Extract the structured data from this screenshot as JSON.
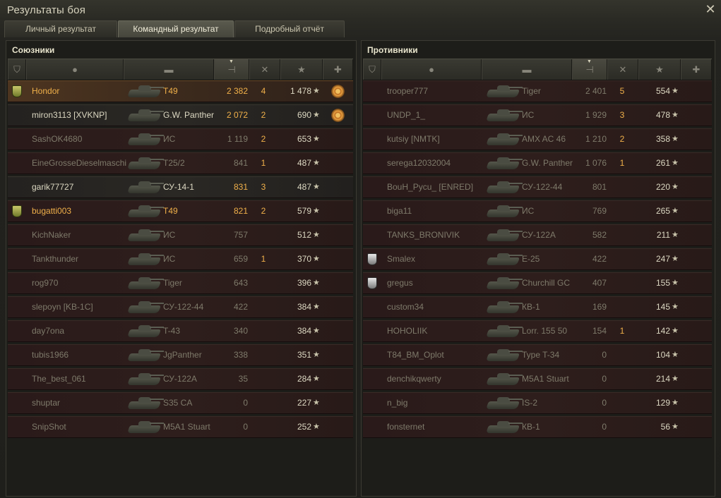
{
  "window": {
    "title": "Результаты боя"
  },
  "tabs": [
    {
      "label": "Личный результат",
      "active": false
    },
    {
      "label": "Командный результат",
      "active": true
    },
    {
      "label": "Подробный отчёт",
      "active": false
    }
  ],
  "allies": {
    "title": "Союзники",
    "rows": [
      {
        "badge": "gold",
        "name": "Hondor",
        "tank": "T49",
        "damage": "2 382",
        "frags": "4",
        "xp": "1 478",
        "medal": true,
        "style": "mine"
      },
      {
        "badge": "",
        "name": "miron3113 [XVKNP]",
        "tank": "G.W. Panther",
        "damage": "2 072",
        "frags": "2",
        "xp": "690",
        "medal": true,
        "style": "bright"
      },
      {
        "badge": "",
        "name": "SashOK4680",
        "tank": "ИС",
        "damage": "1 119",
        "frags": "2",
        "xp": "653",
        "medal": false,
        "style": "dead"
      },
      {
        "badge": "",
        "name": "EineGrosseDieselmaschi",
        "tank": "T25/2",
        "damage": "841",
        "frags": "1",
        "xp": "487",
        "medal": false,
        "style": "dead"
      },
      {
        "badge": "",
        "name": "garik77727",
        "tank": "СУ-14-1",
        "damage": "831",
        "frags": "3",
        "xp": "487",
        "medal": false,
        "style": "bright"
      },
      {
        "badge": "gold",
        "name": "bugatti003",
        "tank": "T49",
        "damage": "821",
        "frags": "2",
        "xp": "579",
        "medal": false,
        "style": "platoon"
      },
      {
        "badge": "",
        "name": "KichNaker",
        "tank": "ИС",
        "damage": "757",
        "frags": "",
        "xp": "512",
        "medal": false,
        "style": "dead"
      },
      {
        "badge": "",
        "name": "Tankthunder",
        "tank": "ИС",
        "damage": "659",
        "frags": "1",
        "xp": "370",
        "medal": false,
        "style": "dead"
      },
      {
        "badge": "",
        "name": "rog970",
        "tank": "Tiger",
        "damage": "643",
        "frags": "",
        "xp": "396",
        "medal": false,
        "style": "dead"
      },
      {
        "badge": "",
        "name": "slepoyn [KB-1C]",
        "tank": "СУ-122-44",
        "damage": "422",
        "frags": "",
        "xp": "384",
        "medal": false,
        "style": "dead"
      },
      {
        "badge": "",
        "name": "day7ona",
        "tank": "T-43",
        "damage": "340",
        "frags": "",
        "xp": "384",
        "medal": false,
        "style": "dead"
      },
      {
        "badge": "",
        "name": "tubis1966",
        "tank": "JgPanther",
        "damage": "338",
        "frags": "",
        "xp": "351",
        "medal": false,
        "style": "dead"
      },
      {
        "badge": "",
        "name": "The_best_061",
        "tank": "СУ-122А",
        "damage": "35",
        "frags": "",
        "xp": "284",
        "medal": false,
        "style": "dead"
      },
      {
        "badge": "",
        "name": "shuptar",
        "tank": "S35 CA",
        "damage": "0",
        "frags": "",
        "xp": "227",
        "medal": false,
        "style": "dead"
      },
      {
        "badge": "",
        "name": "SnipShot",
        "tank": "M5A1 Stuart",
        "damage": "0",
        "frags": "",
        "xp": "252",
        "medal": false,
        "style": "dead"
      }
    ]
  },
  "enemies": {
    "title": "Противники",
    "rows": [
      {
        "badge": "",
        "name": "trooper777",
        "tank": "Tiger",
        "damage": "2 401",
        "frags": "5",
        "xp": "554",
        "medal": false,
        "style": "dead"
      },
      {
        "badge": "",
        "name": "UNDP_1_",
        "tank": "ИС",
        "damage": "1 929",
        "frags": "3",
        "xp": "478",
        "medal": false,
        "style": "dead"
      },
      {
        "badge": "",
        "name": "kutsiy [NMTK]",
        "tank": "AMX AC 46",
        "damage": "1 210",
        "frags": "2",
        "xp": "358",
        "medal": false,
        "style": "dead"
      },
      {
        "badge": "",
        "name": "serega12032004",
        "tank": "G.W. Panther",
        "damage": "1 076",
        "frags": "1",
        "xp": "261",
        "medal": false,
        "style": "dead"
      },
      {
        "badge": "",
        "name": "BouH_Pycu_ [ENRED]",
        "tank": "СУ-122-44",
        "damage": "801",
        "frags": "",
        "xp": "220",
        "medal": false,
        "style": "dead"
      },
      {
        "badge": "",
        "name": "biga11",
        "tank": "ИС",
        "damage": "769",
        "frags": "",
        "xp": "265",
        "medal": false,
        "style": "dead"
      },
      {
        "badge": "",
        "name": "TANKS_BRONIVIK",
        "tank": "СУ-122А",
        "damage": "582",
        "frags": "",
        "xp": "211",
        "medal": false,
        "style": "dead"
      },
      {
        "badge": "silver",
        "name": "Smalex",
        "tank": "E-25",
        "damage": "422",
        "frags": "",
        "xp": "247",
        "medal": false,
        "style": "dead"
      },
      {
        "badge": "silver",
        "name": "gregus",
        "tank": "Churchill GC",
        "damage": "407",
        "frags": "",
        "xp": "155",
        "medal": false,
        "style": "dead"
      },
      {
        "badge": "",
        "name": "custom34",
        "tank": "КВ-1",
        "damage": "169",
        "frags": "",
        "xp": "145",
        "medal": false,
        "style": "dead"
      },
      {
        "badge": "",
        "name": "HOHOLIIK",
        "tank": "Lorr. 155 50",
        "damage": "154",
        "frags": "1",
        "xp": "142",
        "medal": false,
        "style": "dead"
      },
      {
        "badge": "",
        "name": "T84_BM_Oplot",
        "tank": "Type T-34",
        "damage": "0",
        "frags": "",
        "xp": "104",
        "medal": false,
        "style": "dead"
      },
      {
        "badge": "",
        "name": "denchikqwerty",
        "tank": "M5A1 Stuart",
        "damage": "0",
        "frags": "",
        "xp": "214",
        "medal": false,
        "style": "dead"
      },
      {
        "badge": "",
        "name": "n_big",
        "tank": "IS-2",
        "damage": "0",
        "frags": "",
        "xp": "129",
        "medal": false,
        "style": "dead"
      },
      {
        "badge": "",
        "name": "fonsternet",
        "tank": "КВ-1",
        "damage": "0",
        "frags": "",
        "xp": "56",
        "medal": false,
        "style": "dead"
      }
    ]
  },
  "icons": {
    "close": "close-icon",
    "star": "★",
    "header": [
      "badge-column-icon",
      "player-column-icon",
      "tank-column-icon",
      "damage-column-icon",
      "frags-column-icon",
      "xp-column-icon",
      "medal-column-icon"
    ]
  },
  "colors": {
    "gold_text": "#f0b04a",
    "dead_text": "#7e7a6a",
    "alive_text": "#bcb79f"
  }
}
